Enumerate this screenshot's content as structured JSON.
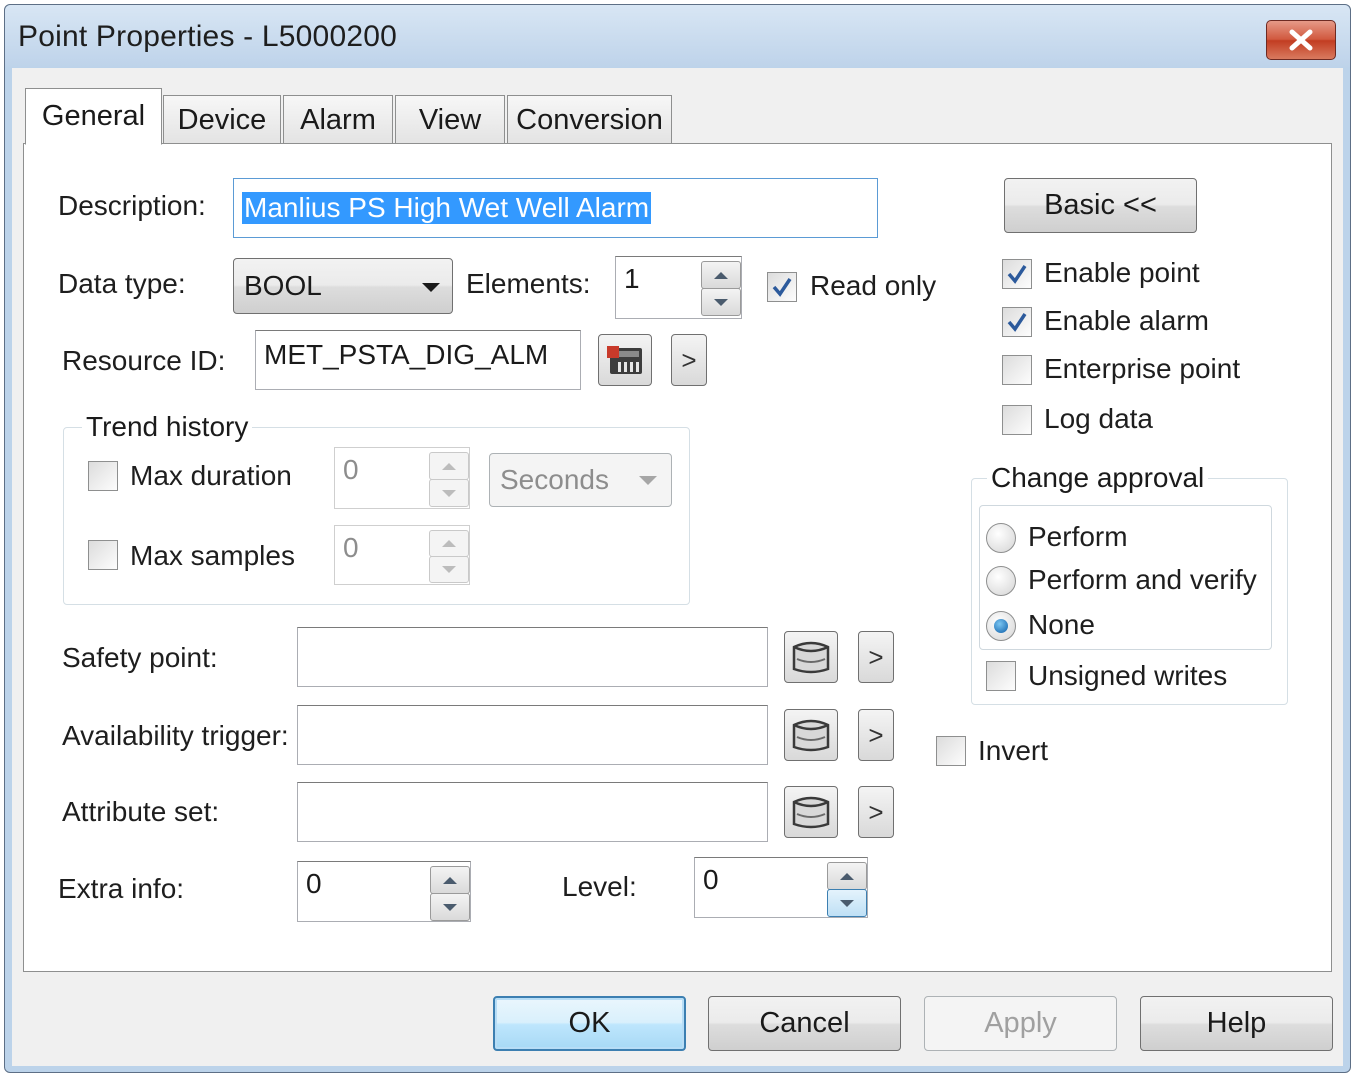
{
  "window": {
    "title": "Point Properties - L5000200",
    "close_label": "✕"
  },
  "tabs": [
    {
      "label": "General",
      "active": true
    },
    {
      "label": "Device",
      "active": false
    },
    {
      "label": "Alarm",
      "active": false
    },
    {
      "label": "View",
      "active": false
    },
    {
      "label": "Conversion",
      "active": false
    }
  ],
  "general": {
    "description_label": "Description:",
    "description_value": "Manlius PS High Wet Well Alarm",
    "data_type_label": "Data type:",
    "data_type_value": "BOOL",
    "elements_label": "Elements:",
    "elements_value": "1",
    "read_only_label": "Read only",
    "read_only_checked": true,
    "resource_id_label": "Resource ID:",
    "resource_id_value": "MET_PSTA_DIG_ALM",
    "arrow_label": ">",
    "basic_button_label": "Basic <<"
  },
  "trend_history": {
    "title": "Trend history",
    "max_duration_label": "Max duration",
    "max_duration_checked": false,
    "max_duration_value": "0",
    "duration_unit": "Seconds",
    "max_samples_label": "Max samples",
    "max_samples_checked": false,
    "max_samples_value": "0"
  },
  "options": {
    "enable_point_label": "Enable point",
    "enable_point_checked": true,
    "enable_alarm_label": "Enable alarm",
    "enable_alarm_checked": true,
    "enterprise_point_label": "Enterprise point",
    "enterprise_point_checked": false,
    "log_data_label": "Log data",
    "log_data_checked": false
  },
  "change_approval": {
    "title": "Change approval",
    "perform_label": "Perform",
    "perform_verify_label": "Perform and verify",
    "none_label": "None",
    "selected": "None",
    "unsigned_writes_label": "Unsigned writes",
    "unsigned_writes_checked": false
  },
  "links": {
    "safety_point_label": "Safety point:",
    "safety_point_value": "",
    "availability_trigger_label": "Availability trigger:",
    "availability_trigger_value": "",
    "invert_label": "Invert",
    "invert_checked": false,
    "attribute_set_label": "Attribute set:",
    "attribute_set_value": ""
  },
  "extra": {
    "extra_info_label": "Extra info:",
    "extra_info_value": "0",
    "level_label": "Level:",
    "level_value": "0"
  },
  "footer": {
    "ok_label": "OK",
    "cancel_label": "Cancel",
    "apply_label": "Apply",
    "help_label": "Help"
  },
  "colors": {
    "selection": "#3399ff",
    "titlebar": "#bed3ea",
    "close_button": "#c23d22",
    "dialog_bg": "#f0f0f0"
  },
  "icons": {
    "close": "close-icon",
    "checkmark": "checkmark-icon",
    "resource_browse": "resource-browse-icon",
    "point_browse": "point-browse-icon",
    "dropdown": "chevron-down-icon",
    "spin_up": "spin-up-icon",
    "spin_down": "spin-down-icon"
  }
}
